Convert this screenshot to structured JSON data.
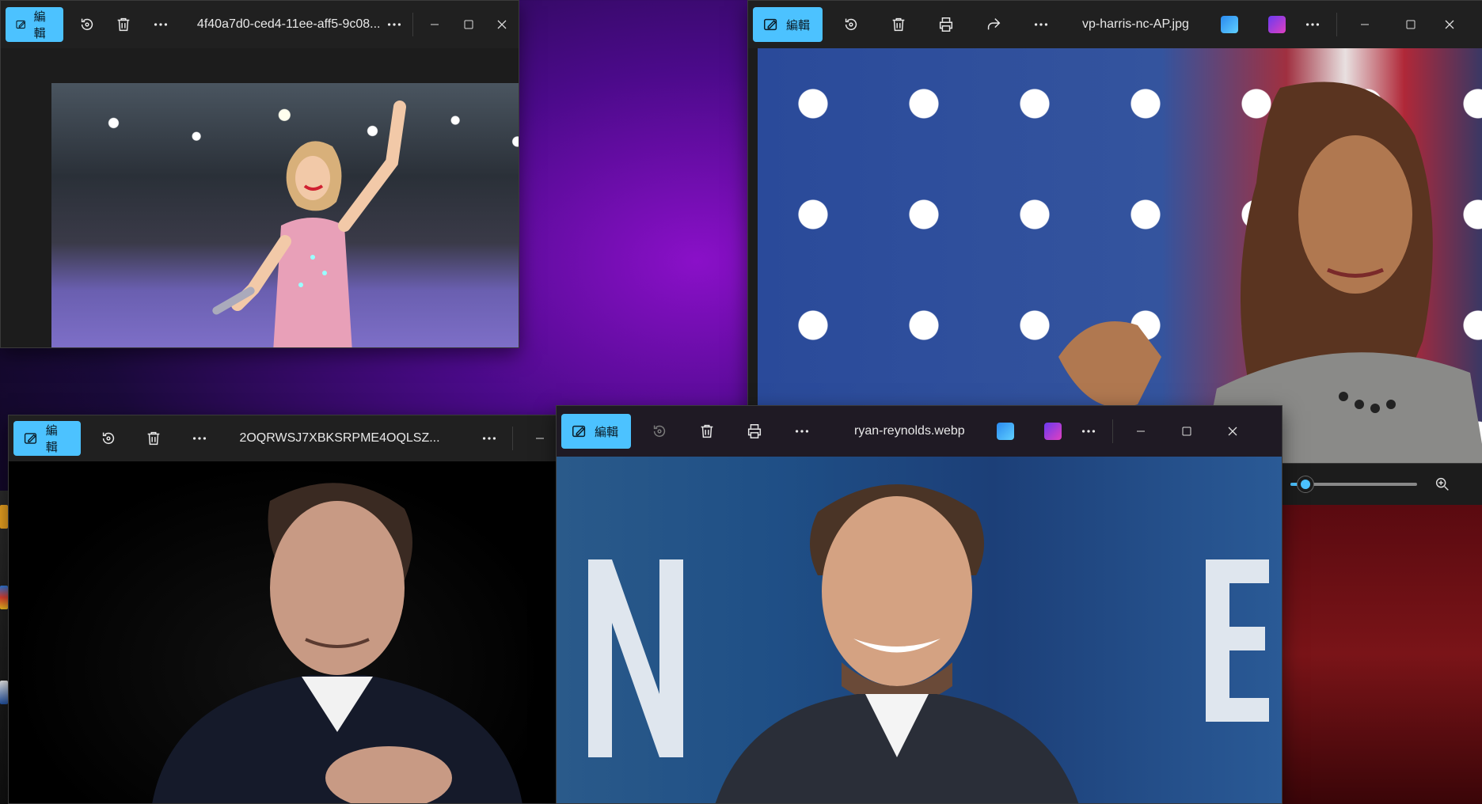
{
  "windows": {
    "w1": {
      "edit_label": "編輯",
      "title": "4f40a7d0-ced4-11ee-aff5-9c08..."
    },
    "w2": {
      "edit_label": "編輯",
      "title": "vp-harris-nc-AP.jpg"
    },
    "w3": {
      "edit_label": "編輯",
      "title": "2OQRWSJ7XBKSRPME4OQLSZ..."
    },
    "w4": {
      "edit_label": "編輯",
      "title": "ryan-reynolds.webp"
    }
  },
  "zoom": {
    "level_fraction": 0.12
  },
  "colors": {
    "accent": "#4cc2ff",
    "titlebar": "#202020",
    "window_bg": "#1c1c1c"
  },
  "icons": [
    "edit-icon",
    "rotate-icon",
    "delete-icon",
    "print-icon",
    "share-icon",
    "more-icon",
    "minimize-icon",
    "maximize-icon",
    "close-icon",
    "zoom-in-icon",
    "photos-editor-icon",
    "clipchamp-icon"
  ]
}
